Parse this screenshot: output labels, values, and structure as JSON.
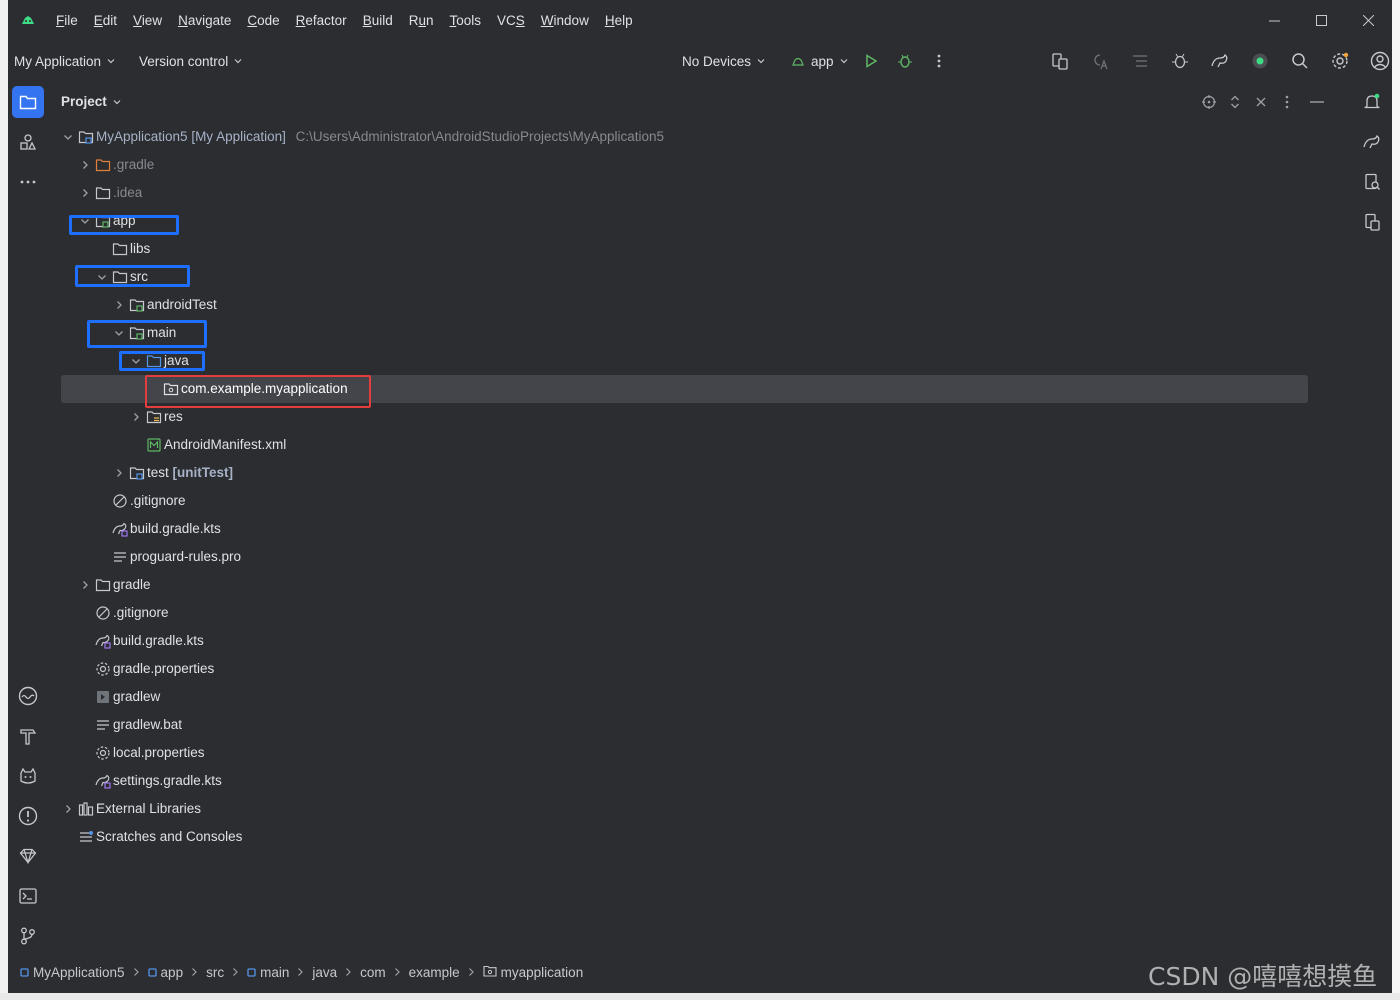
{
  "menu": [
    "File",
    "Edit",
    "View",
    "Navigate",
    "Code",
    "Refactor",
    "Build",
    "Run",
    "Tools",
    "VCS",
    "Window",
    "Help"
  ],
  "menu_mnemonics": [
    "F",
    "E",
    "V",
    "N",
    "C",
    "R",
    "B",
    "u",
    "T",
    "S",
    "W",
    "H"
  ],
  "toolbar": {
    "project_widget": "My Application",
    "vcs_widget": "Version control",
    "device_selector": "No Devices",
    "run_config": "app"
  },
  "panel": {
    "title": "Project"
  },
  "tree": {
    "root_name": "MyApplication5",
    "root_module": "[My Application]",
    "root_path": "C:\\Users\\Administrator\\AndroidStudioProjects\\MyApplication5",
    "items": [
      ".gradle",
      ".idea",
      "app",
      "libs",
      "src",
      "androidTest",
      "main",
      "java",
      "com.example.myapplication",
      "res",
      "AndroidManifest.xml",
      "test",
      "[unitTest]",
      ".gitignore",
      "build.gradle.kts",
      "proguard-rules.pro",
      "gradle",
      ".gitignore",
      "build.gradle.kts",
      "gradle.properties",
      "gradlew",
      "gradlew.bat",
      "local.properties",
      "settings.gradle.kts",
      "External Libraries",
      "Scratches and Consoles"
    ]
  },
  "breadcrumb": [
    "MyApplication5",
    "app",
    "src",
    "main",
    "java",
    "com",
    "example",
    "myapplication"
  ],
  "watermark": "CSDN @嘻嘻想摸鱼",
  "colors": {
    "background": "#2b2d30",
    "selection": "#43454a",
    "highlight_blue": "#1e6fff",
    "highlight_red": "#e43d3d",
    "run_green": "#5fb865",
    "active_tool": "#3574f0"
  }
}
